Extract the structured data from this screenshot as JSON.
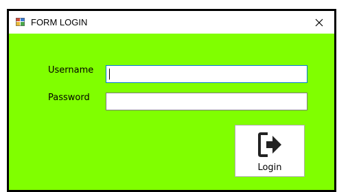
{
  "window": {
    "title": "FORM LOGIN"
  },
  "form": {
    "username_label": "Username",
    "username_value": "",
    "password_label": "Password",
    "password_value": "",
    "login_label": "Login"
  },
  "colors": {
    "client_background": "#80ff00",
    "focus_border": "#0078d7"
  },
  "icons": {
    "app": "form-app-icon",
    "close": "close-icon",
    "login": "sign-in-arrow-icon"
  }
}
